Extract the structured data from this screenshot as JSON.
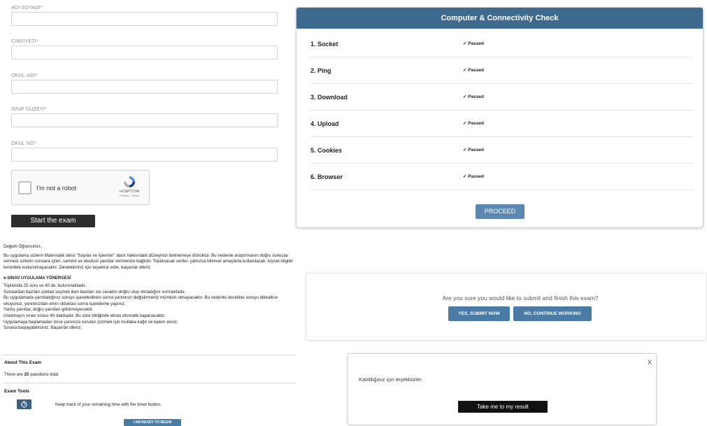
{
  "form": {
    "fields": [
      {
        "label": "ADI-SOYADI*",
        "value": ""
      },
      {
        "label": "CINSIYETI*",
        "value": ""
      },
      {
        "label": "OKUL-ADI*",
        "value": ""
      },
      {
        "label": "SINIF DÜZEYI*",
        "value": ""
      },
      {
        "label": "OKUL NO*",
        "value": ""
      }
    ],
    "captcha": {
      "label": "I'm not a robot",
      "brand": "reCAPTCHA",
      "terms": "Privacy - Terms"
    },
    "start_button": "Start the exam"
  },
  "instructions": {
    "greeting": "Değerli Öğrencimiz,",
    "intro": "Bu uygulama sizlerin Matematik dersi \"Sayılar ve İşlemler\" alanı hakkındaki düzeyinizi belirlemeye dönüktür. Bu nedenle araştırmanın doğru sonuçlar vermesi sizlerin sorulara içten, samimi ve eksiksiz yanıtlar vermenize bağlıdır. Toplanacak veriler, yalnızca bilimsel amaçlarla kullanılacak, kişisel bilgiler kesinlikle kullanılmayacaktır. Destekleriniz için teşekkür eder, başarılar dileriz.",
    "heading": "e-SINAV UYGULAMA YÖNERGESİ",
    "bullets": [
      " Toplamda 25 soru ve 40 dk. bulunmaktadır.",
      " Sorulardan bazıları çoktan seçmeli iken bazıları ise cevabın doğru olup olmadığını sormaktadır.",
      " Bu uygulamada yanıtladığınız soruyu işaretledikten sonra yanıtınızı değiştirmeniz mümkün olmayacaktır. Bu nedenle öncelikle soruyu dikkatlice okuyunuz, yanıtınızdan emin olduktan sonra işaretleme yapınız.",
      " Yanlış yanıtlar, doğru yanıtları götürmeyecektir.",
      " Unutmayın sınav süresi 40 dakikadır. Bu süre bittiğinde ekran otomatik kapanacaktır.",
      " Uygulamaya başlamadan önce yanınıza soruları çözmek için mutlaka kağıt ve kalem alınız."
    ],
    "closing": "Sınava başlayabilirsiniz. Başarılar dileriz."
  },
  "about": {
    "title": "About This Exam",
    "text_before": "There are ",
    "count": "25",
    "text_after": " questions total."
  },
  "tools": {
    "title": "Exam Tools",
    "timer_icon": "stopwatch-icon",
    "timer_text": "Keep track of your remaining time with the timer button.",
    "ready_button": "I AM READY TO BEGIN"
  },
  "connectivity": {
    "title": "Computer & Connectivity Check",
    "checks": [
      {
        "name": "1. Socket",
        "status": "✓ Passed"
      },
      {
        "name": "2. Ping",
        "status": "✓ Passed"
      },
      {
        "name": "3. Download",
        "status": "✓ Passed"
      },
      {
        "name": "4. Upload",
        "status": "✓ Passed"
      },
      {
        "name": "5. Cookies",
        "status": "✓ Passed"
      },
      {
        "name": "6. Browser",
        "status": "✓ Passed"
      }
    ],
    "proceed": "PROCEED",
    "header_color": "#3f6a8f"
  },
  "submit_dialog": {
    "question": "Are you sure you would like to submit and finish this exam?",
    "yes": "YES, SUBMIT NOW",
    "no": "NO, CONTINUE WORKING"
  },
  "thanks": {
    "close": "X",
    "message": "Katıldığınız için teşekkürler.",
    "button": "Take me to my result"
  }
}
